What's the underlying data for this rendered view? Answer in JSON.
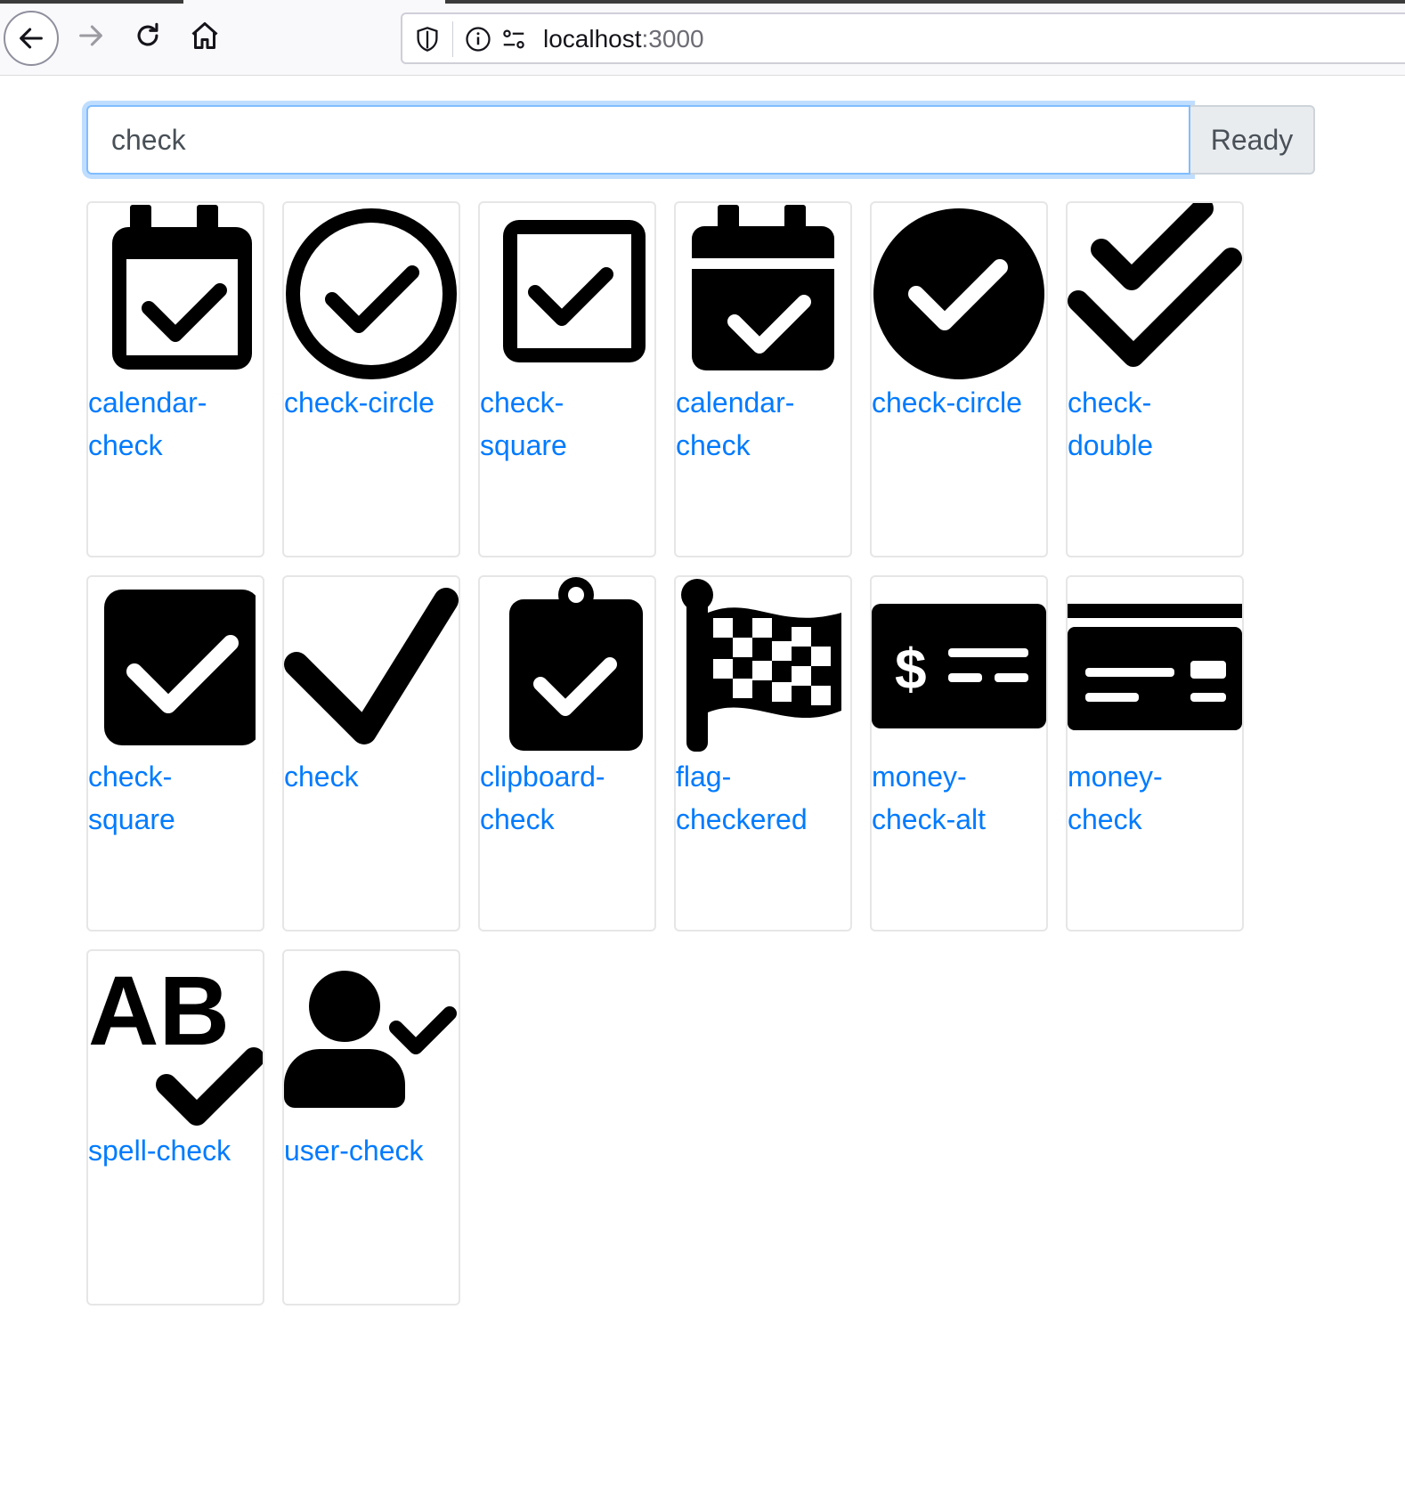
{
  "browser": {
    "url_host": "localhost",
    "url_port": ":3000"
  },
  "search": {
    "value": "check",
    "status": "Ready"
  },
  "results": [
    {
      "label": "calendar-check",
      "icon": "calendar-check-regular-icon"
    },
    {
      "label": "check-circle",
      "icon": "check-circle-regular-icon"
    },
    {
      "label": "check-square",
      "icon": "check-square-regular-icon"
    },
    {
      "label": "calendar-check",
      "icon": "calendar-check-solid-icon"
    },
    {
      "label": "check-circle",
      "icon": "check-circle-solid-icon"
    },
    {
      "label": "check-double",
      "icon": "check-double-icon"
    },
    {
      "label": "check-square",
      "icon": "check-square-solid-icon"
    },
    {
      "label": "check",
      "icon": "check-icon"
    },
    {
      "label": "clipboard-check",
      "icon": "clipboard-check-icon"
    },
    {
      "label": "flag-checkered",
      "icon": "flag-checkered-icon"
    },
    {
      "label": "money-check-alt",
      "icon": "money-check-alt-icon"
    },
    {
      "label": "money-check",
      "icon": "money-check-icon"
    },
    {
      "label": "spell-check",
      "icon": "spell-check-icon"
    },
    {
      "label": "user-check",
      "icon": "user-check-icon"
    }
  ],
  "colors": {
    "link": "#007bff",
    "focus_border": "#80bdff"
  }
}
